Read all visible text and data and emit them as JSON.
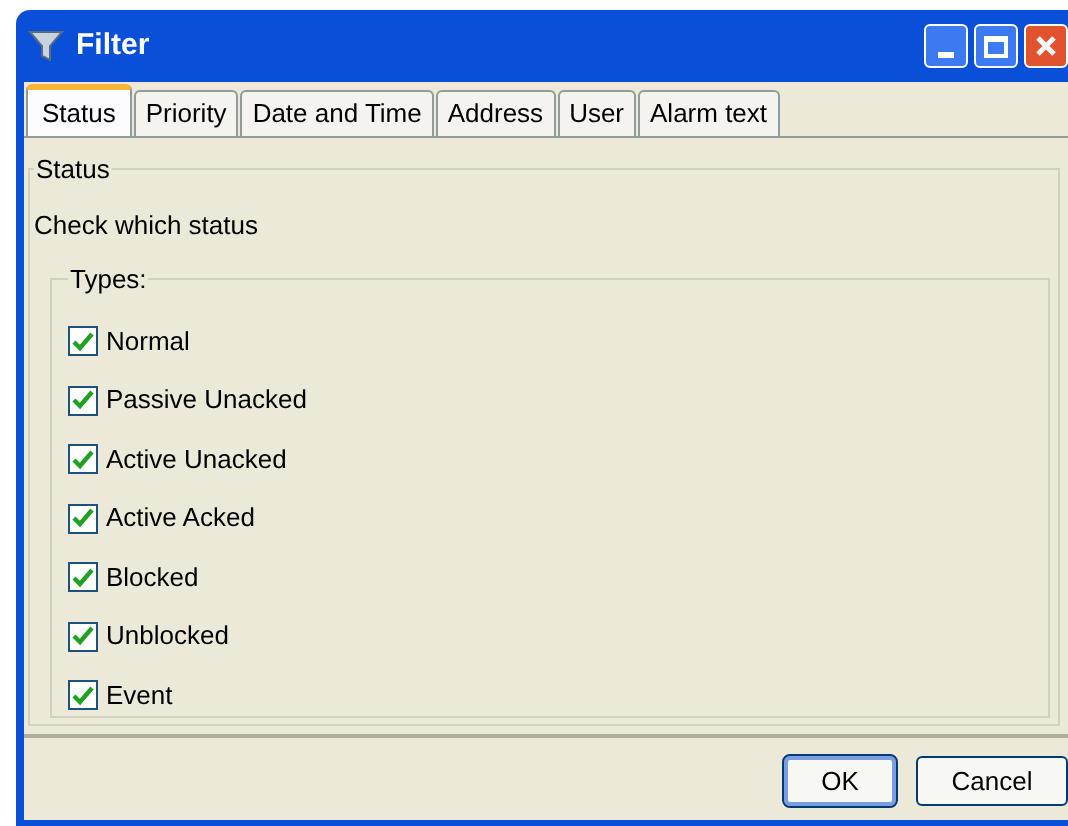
{
  "window": {
    "title": "Filter"
  },
  "tabs": [
    {
      "label": "Status",
      "selected": true
    },
    {
      "label": "Priority",
      "selected": false
    },
    {
      "label": "Date and Time",
      "selected": false
    },
    {
      "label": "Address",
      "selected": false
    },
    {
      "label": "User",
      "selected": false
    },
    {
      "label": "Alarm text",
      "selected": false
    }
  ],
  "status_group": {
    "title": "Status",
    "instruction": "Check which status",
    "types_group": {
      "title": "Types:",
      "items": [
        {
          "label": "Normal",
          "checked": true
        },
        {
          "label": "Passive Unacked",
          "checked": true
        },
        {
          "label": "Active Unacked",
          "checked": true
        },
        {
          "label": "Active Acked",
          "checked": true
        },
        {
          "label": "Blocked",
          "checked": true
        },
        {
          "label": "Unblocked",
          "checked": true
        },
        {
          "label": "Event",
          "checked": true
        }
      ]
    }
  },
  "buttons": [
    {
      "label": "OK",
      "default": true
    },
    {
      "label": "Cancel",
      "default": false
    }
  ]
}
